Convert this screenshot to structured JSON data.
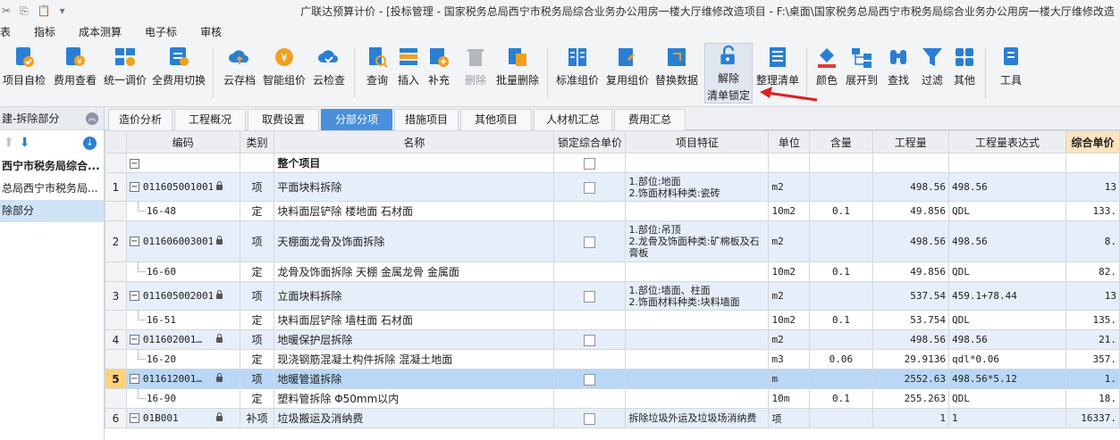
{
  "window": {
    "title": "广联达预算计价 - [投标管理 - 国家税务总局西宁市税务局综合业务办公用房一楼大厅维修改造项目 - F:\\桌面\\国家税务总局西宁市税务局综合业务办公用房一楼大厅维修改造"
  },
  "menu": [
    "表",
    "指标",
    "成本测算",
    "电子标",
    "审核"
  ],
  "ribbon": {
    "buttons": [
      {
        "label": "项目自检",
        "icon": "check-icon"
      },
      {
        "label": "费用查看",
        "icon": "cost-view-icon"
      },
      {
        "label": "统一调价",
        "icon": "adjust-price-icon"
      },
      {
        "label": "全费用切换",
        "icon": "switch-icon"
      },
      {
        "label": "云存档",
        "icon": "cloud-upload-icon"
      },
      {
        "label": "智能组价",
        "icon": "smart-price-icon"
      },
      {
        "label": "云检查",
        "icon": "cloud-check-icon"
      },
      {
        "label": "查询",
        "icon": "query-icon"
      },
      {
        "label": "插入",
        "icon": "insert-icon"
      },
      {
        "label": "补充",
        "icon": "supplement-icon"
      },
      {
        "label": "删除",
        "icon": "trash-icon"
      },
      {
        "label": "批量删除",
        "icon": "batch-delete-icon"
      },
      {
        "label": "标准组价",
        "icon": "standard-price-icon"
      },
      {
        "label": "复用组价",
        "icon": "reuse-price-icon"
      },
      {
        "label": "替换数据",
        "icon": "replace-icon"
      },
      {
        "label": "解除",
        "label2": "清单锁定",
        "icon": "unlock-icon"
      },
      {
        "label": "整理清单",
        "icon": "organize-icon"
      },
      {
        "label": "颜色",
        "icon": "paint-bucket-icon"
      },
      {
        "label": "展开到",
        "icon": "expand-icon"
      },
      {
        "label": "查找",
        "icon": "binoculars-icon"
      },
      {
        "label": "过滤",
        "icon": "filter-icon"
      },
      {
        "label": "其他",
        "icon": "grid-icon"
      },
      {
        "label": "工具",
        "icon": "tool-icon"
      }
    ]
  },
  "left_panel": {
    "header": "建-拆除部分",
    "tree": [
      {
        "label": "西宁市税务局综合..."
      },
      {
        "label": "总局西宁市税务局..."
      },
      {
        "label": "除部分"
      }
    ]
  },
  "tabs": [
    "造价分析",
    "工程概况",
    "取费设置",
    "分部分项",
    "措施项目",
    "其他项目",
    "人材机汇总",
    "费用汇总"
  ],
  "active_tab": "分部分项",
  "columns": [
    "编码",
    "类别",
    "名称",
    "锁定综合单价",
    "项目特征",
    "单位",
    "含量",
    "工程量",
    "工程量表达式",
    "综合单价"
  ],
  "whole_row": {
    "name": "整个项目"
  },
  "rows": [
    {
      "num": "1",
      "code": "011605001001",
      "type": "项",
      "name": "平面块料拆除",
      "feature": "1.部位:地面\n2.饰面材料种类:瓷砖",
      "unit": "m2",
      "content": "",
      "qty": "498.56",
      "expr": "498.56",
      "price": "13",
      "kind": "item"
    },
    {
      "num": "",
      "code": "16-48",
      "type": "定",
      "name": "块料面层铲除 楼地面 石材面",
      "feature": "",
      "unit": "10m2",
      "content": "0.1",
      "qty": "49.856",
      "expr": "QDL",
      "price": "133.",
      "kind": "sub"
    },
    {
      "num": "2",
      "code": "011606003001",
      "type": "项",
      "name": "天棚面龙骨及饰面拆除",
      "feature": "1.部位:吊顶\n2.龙骨及饰面种类:矿棉板及石膏板",
      "unit": "m2",
      "content": "",
      "qty": "498.56",
      "expr": "498.56",
      "price": "8.",
      "kind": "item"
    },
    {
      "num": "",
      "code": "16-60",
      "type": "定",
      "name": "龙骨及饰面拆除 天棚 金属龙骨 金属面",
      "feature": "",
      "unit": "10m2",
      "content": "0.1",
      "qty": "49.856",
      "expr": "QDL",
      "price": "82.",
      "kind": "sub"
    },
    {
      "num": "3",
      "code": "011605002001",
      "type": "项",
      "name": "立面块料拆除",
      "feature": "1.部位:墙面、柱面\n2.饰面材料种类:块料墙面",
      "unit": "m2",
      "content": "",
      "qty": "537.54",
      "expr": "459.1+78.44",
      "price": "13",
      "kind": "item"
    },
    {
      "num": "",
      "code": "16-51",
      "type": "定",
      "name": "块料面层铲除 墙柱面 石材面",
      "feature": "",
      "unit": "10m2",
      "content": "0.1",
      "qty": "53.754",
      "expr": "QDL",
      "price": "135.",
      "kind": "sub"
    },
    {
      "num": "4",
      "code": "011602001…",
      "type": "项",
      "name": "地暖保护层拆除",
      "feature": "",
      "unit": "m2",
      "content": "",
      "qty": "498.56",
      "expr": "498.56",
      "price": "21.",
      "kind": "item"
    },
    {
      "num": "",
      "code": "16-20",
      "type": "定",
      "name": "现浇钢筋混凝土构件拆除 混凝土地面",
      "feature": "",
      "unit": "m3",
      "content": "0.06",
      "qty": "29.9136",
      "expr": "qdl*0.06",
      "price": "357.",
      "kind": "sub"
    },
    {
      "num": "5",
      "code": "011612001…",
      "type": "项",
      "name": "地暖管道拆除",
      "feature": "",
      "unit": "m",
      "content": "",
      "qty": "2552.63",
      "expr": "498.56*5.12",
      "price": "1.",
      "kind": "selected"
    },
    {
      "num": "",
      "code": "16-90",
      "type": "定",
      "name": "塑料管拆除 Φ50mm以内",
      "feature": "",
      "unit": "10m",
      "content": "0.1",
      "qty": "255.263",
      "expr": "QDL",
      "price": "18.",
      "kind": "sub"
    },
    {
      "num": "6",
      "code": "01B001",
      "type": "补项",
      "name": "垃圾搬运及消纳费",
      "feature": "拆除垃圾外运及垃圾场消纳费",
      "unit": "项",
      "content": "",
      "qty": "1",
      "expr": "1",
      "price": "16337.",
      "kind": "item"
    }
  ]
}
